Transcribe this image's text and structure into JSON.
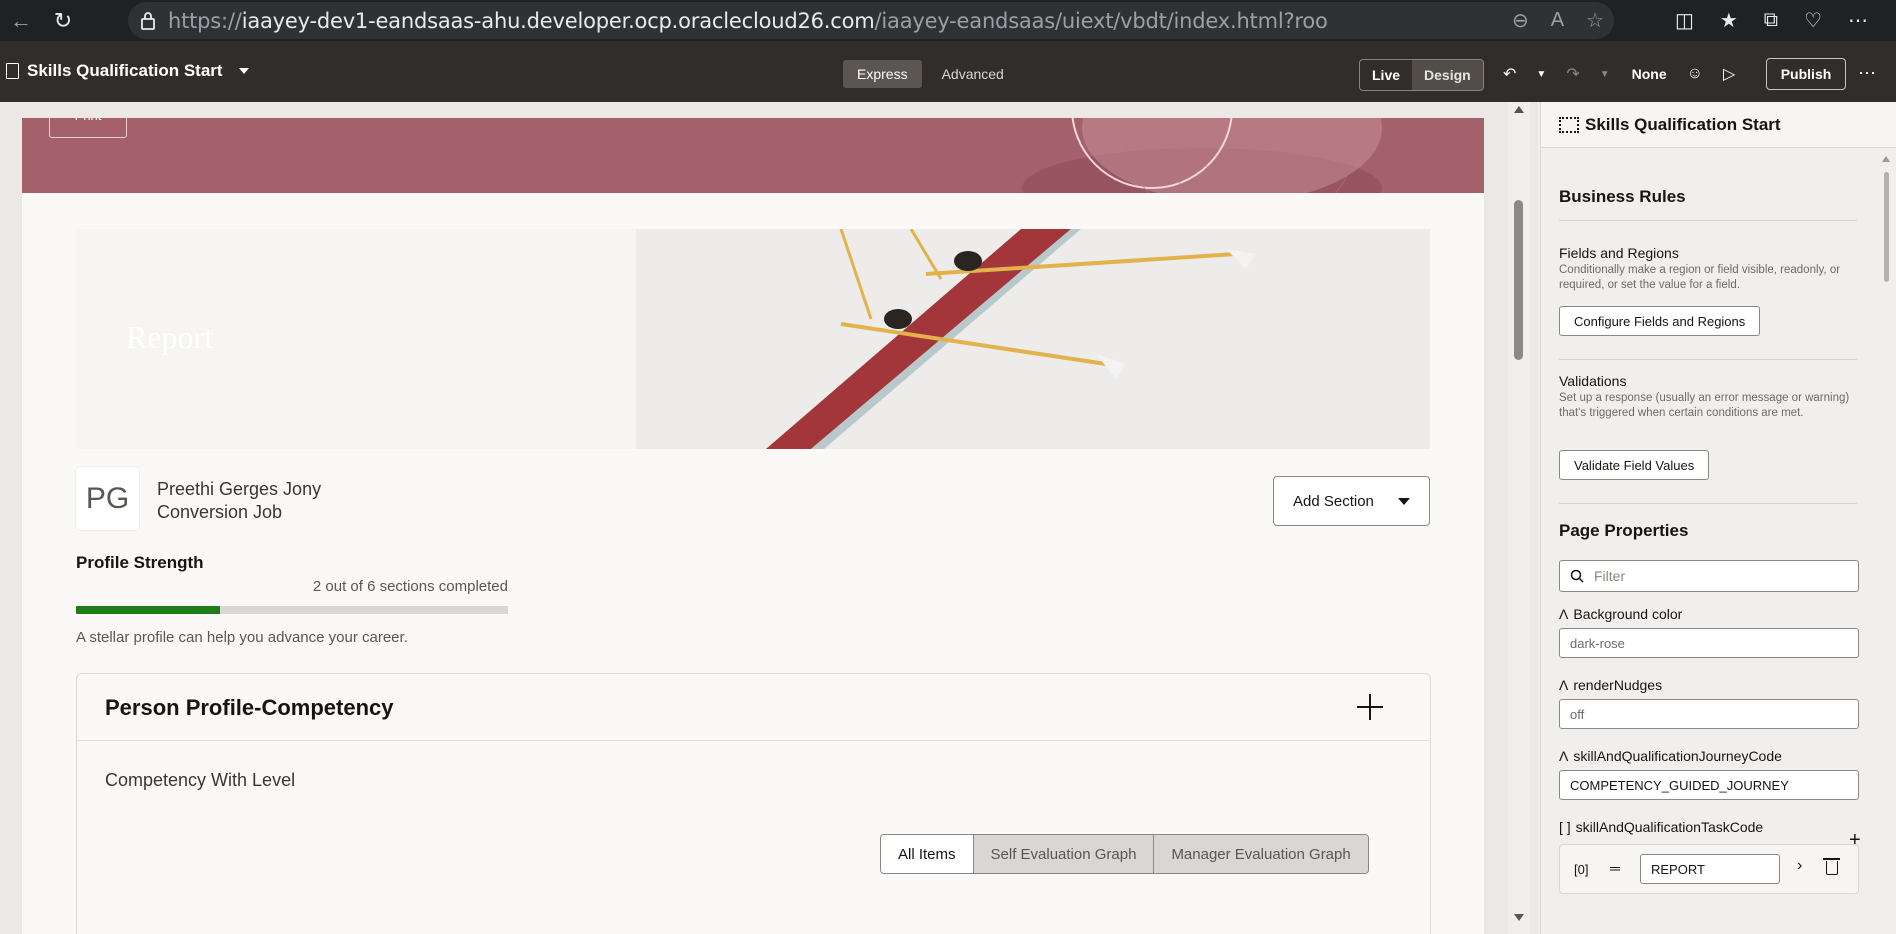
{
  "browser": {
    "url_scheme": "https://",
    "url_host": "iaayey-dev1-eandsaas-ahu.developer.ocp.oraclecloud26.com",
    "url_path": "/iaayey-eandsaas/uiext/vbdt/index.html?root=applicati..."
  },
  "toolbar": {
    "page_title": "Skills Qualification Start",
    "mode_express": "Express",
    "mode_advanced": "Advanced",
    "live_label": "Live",
    "design_label": "Design",
    "none_label": "None",
    "publish_label": "Publish"
  },
  "canvas": {
    "print_label": "Print",
    "hero_title": "Report",
    "avatar_initials": "PG",
    "person_name": "Preethi Gerges Jony",
    "person_job": "Conversion Job",
    "add_section_label": "Add Section",
    "profile_strength_title": "Profile Strength",
    "profile_strength_count": "2 out of 6 sections completed",
    "profile_strength_progress": 0.333,
    "profile_strength_hint": "A stellar profile can help you advance your career.",
    "card_title": "Person Profile-Competency",
    "card_subtitle": "Competency With Level",
    "segments": [
      "All Items",
      "Self Evaluation Graph",
      "Manager Evaluation Graph"
    ]
  },
  "panel": {
    "title": "Skills Qualification Start",
    "business_rules": "Business Rules",
    "fields_regions_title": "Fields and Regions",
    "fields_regions_desc": "Conditionally make a region or field visible, readonly, or required, or set the value for a field.",
    "configure_btn": "Configure Fields and Regions",
    "validations_title": "Validations",
    "validations_desc": "Set up a response (usually an error message or warning) that's triggered when certain conditions are met.",
    "validate_btn": "Validate Field Values",
    "page_properties": "Page Properties",
    "filter_placeholder": "Filter",
    "props": [
      {
        "label": "Background color",
        "value": "dark-rose"
      },
      {
        "label": "renderNudges",
        "value": "off"
      },
      {
        "label": "skillAndQualificationJourneyCode",
        "value": "COMPETENCY_GUIDED_JOURNEY"
      }
    ],
    "task_code_label": "skillAndQualificationTaskCode",
    "task_code_index": "[0]",
    "task_code_value": "REPORT"
  },
  "colors": {
    "banner": "#a5616b",
    "progress": "#1e7d18",
    "toolbar": "#312d2a"
  }
}
